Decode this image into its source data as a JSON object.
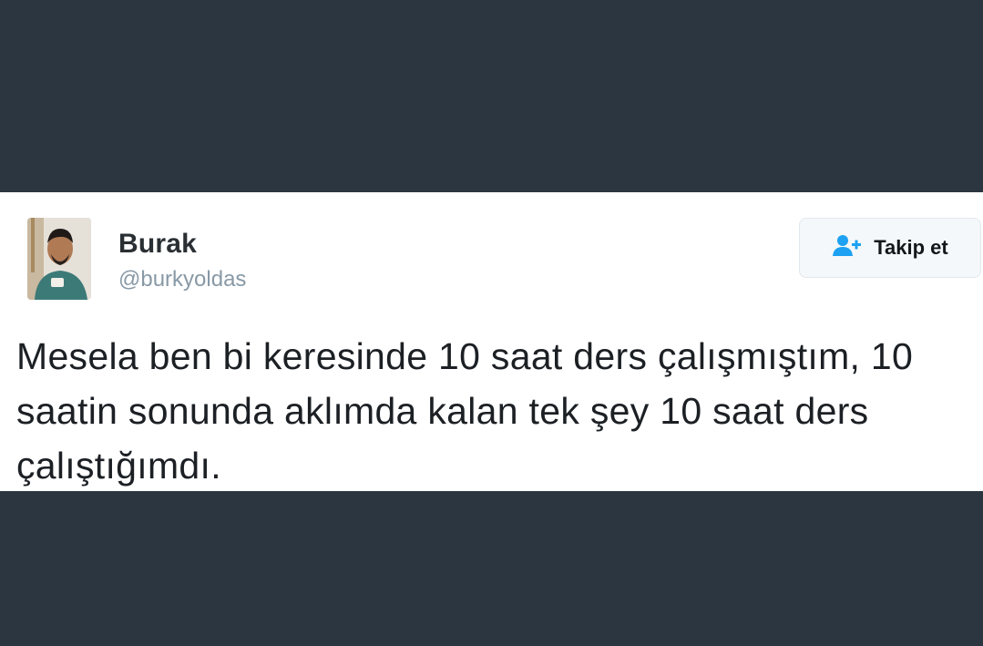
{
  "tweet": {
    "author": {
      "name": "Burak",
      "handle": "@burkyoldas"
    },
    "follow_button": {
      "label": "Takip et",
      "icon": "person-plus-icon"
    },
    "text": "Mesela ben bi keresinde 10 saat ders çalışmıştım, 10 saatin sonunda aklımda kalan tek şey 10 saat ders çalıştığımdı."
  },
  "colors": {
    "page_background": "#2c3640",
    "card_background": "#ffffff",
    "follow_icon": "#1da1f2",
    "name": "#292f33",
    "handle": "#8899a6"
  }
}
